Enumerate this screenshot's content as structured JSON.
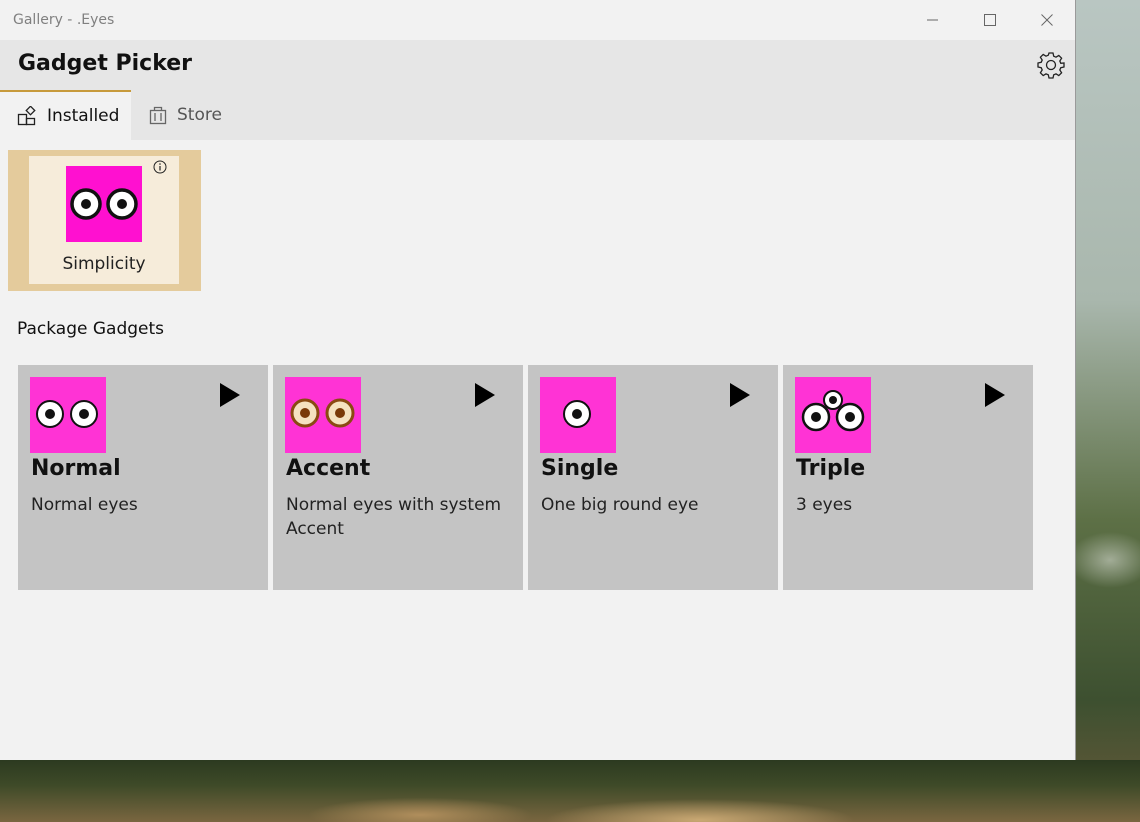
{
  "window": {
    "title": "Gallery - .Eyes"
  },
  "header": {
    "app_title": "Gadget Picker"
  },
  "tabs": [
    {
      "label": "Installed",
      "selected": true,
      "icon": "installed-icon"
    },
    {
      "label": "Store",
      "selected": false,
      "icon": "store-bag-icon"
    }
  ],
  "installed": [
    {
      "label": "Simplicity",
      "icon": "two-eyes-icon"
    }
  ],
  "package_section": {
    "title": "Package Gadgets"
  },
  "gadgets": [
    {
      "name": "Normal",
      "description": "Normal eyes",
      "icon": "two-eyes-icon"
    },
    {
      "name": "Accent",
      "description": "Normal eyes with system Accent",
      "icon": "accent-eyes-icon"
    },
    {
      "name": "Single",
      "description": "One big round eye",
      "icon": "single-eye-icon"
    },
    {
      "name": "Triple",
      "description": "3 eyes",
      "icon": "triple-eyes-icon"
    }
  ],
  "colors": {
    "gadget_pink": "#ff33d5",
    "selected_pink": "#ff10d0",
    "accent_tab": "#c79a3b",
    "installed_card_bg": "#e4cb9c",
    "accent_eye": "#f5e2c0",
    "accent_eye_ring": "#8a4a12"
  }
}
